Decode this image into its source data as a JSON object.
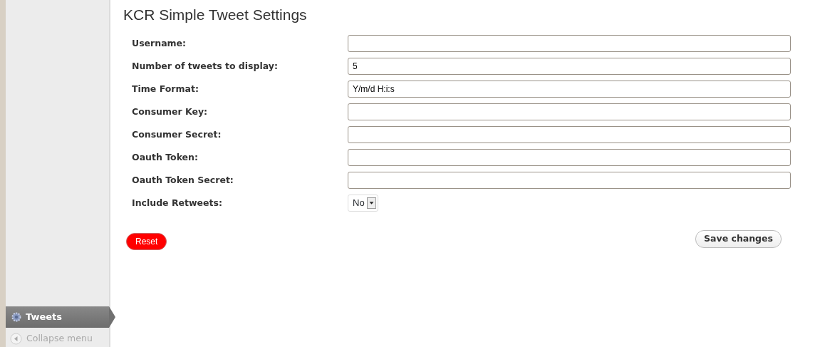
{
  "sidebar": {
    "items": [
      {
        "label": "Tweets",
        "selected": true
      }
    ],
    "collapse": "Collapse menu"
  },
  "title": "KCR Simple Tweet Settings",
  "fields": [
    {
      "label": "Username:",
      "kind": "text"
    },
    {
      "label": "Number of tweets to display:",
      "kind": "text",
      "value": "5"
    },
    {
      "label": "Time Format:",
      "kind": "text",
      "value": "Y/m/d H:i:s"
    },
    {
      "label": "Consumer Key:",
      "kind": "text"
    },
    {
      "label": "Consumer Secret:",
      "kind": "text"
    },
    {
      "label": "Oauth Token:",
      "kind": "text"
    },
    {
      "label": "Oauth Token Secret:",
      "kind": "text"
    },
    {
      "label": "Include Retweets:",
      "kind": "select",
      "value": "No"
    }
  ],
  "buttons": {
    "reset": "Reset",
    "save": "Save changes"
  }
}
